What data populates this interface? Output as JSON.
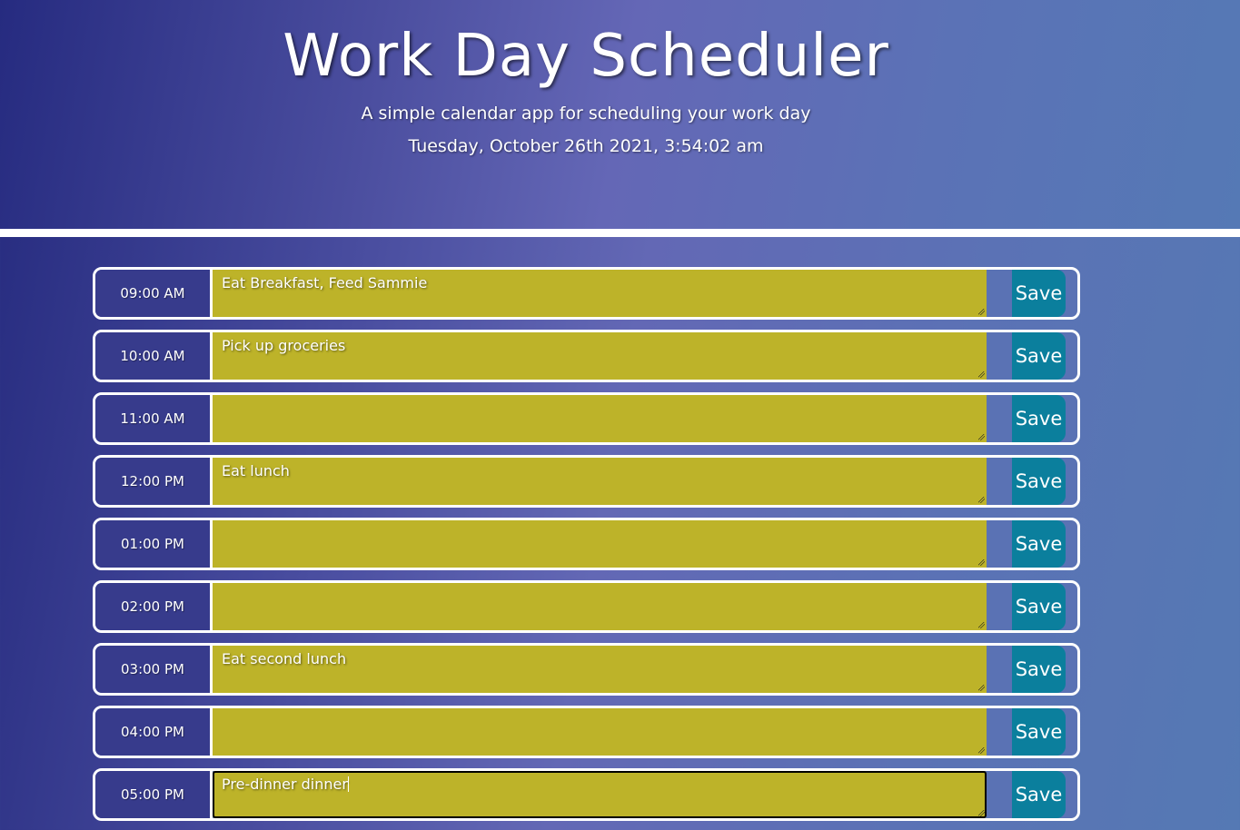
{
  "header": {
    "title": "Work Day Scheduler",
    "subtitle": "A simple calendar app for scheduling your work day",
    "datetime": "Tuesday, October 26th 2021, 3:54:02 am"
  },
  "rows": [
    {
      "hour": "09:00 AM",
      "task": "Eat Breakfast, Feed Sammie",
      "save_label": "Save"
    },
    {
      "hour": "10:00 AM",
      "task": "Pick up groceries",
      "save_label": "Save"
    },
    {
      "hour": "11:00 AM",
      "task": "",
      "save_label": "Save"
    },
    {
      "hour": "12:00 PM",
      "task": "Eat lunch",
      "save_label": "Save"
    },
    {
      "hour": "01:00 PM",
      "task": "",
      "save_label": "Save"
    },
    {
      "hour": "02:00 PM",
      "task": "",
      "save_label": "Save"
    },
    {
      "hour": "03:00 PM",
      "task": "Eat second lunch",
      "save_label": "Save"
    },
    {
      "hour": "04:00 PM",
      "task": "",
      "save_label": "Save"
    },
    {
      "hour": "05:00 PM",
      "task": "Pre-dinner dinner",
      "save_label": "Save"
    }
  ],
  "colors": {
    "hour_bg": "#373b8c",
    "task_bg": "#bdb329",
    "save_bg": "#0b7f9d"
  }
}
